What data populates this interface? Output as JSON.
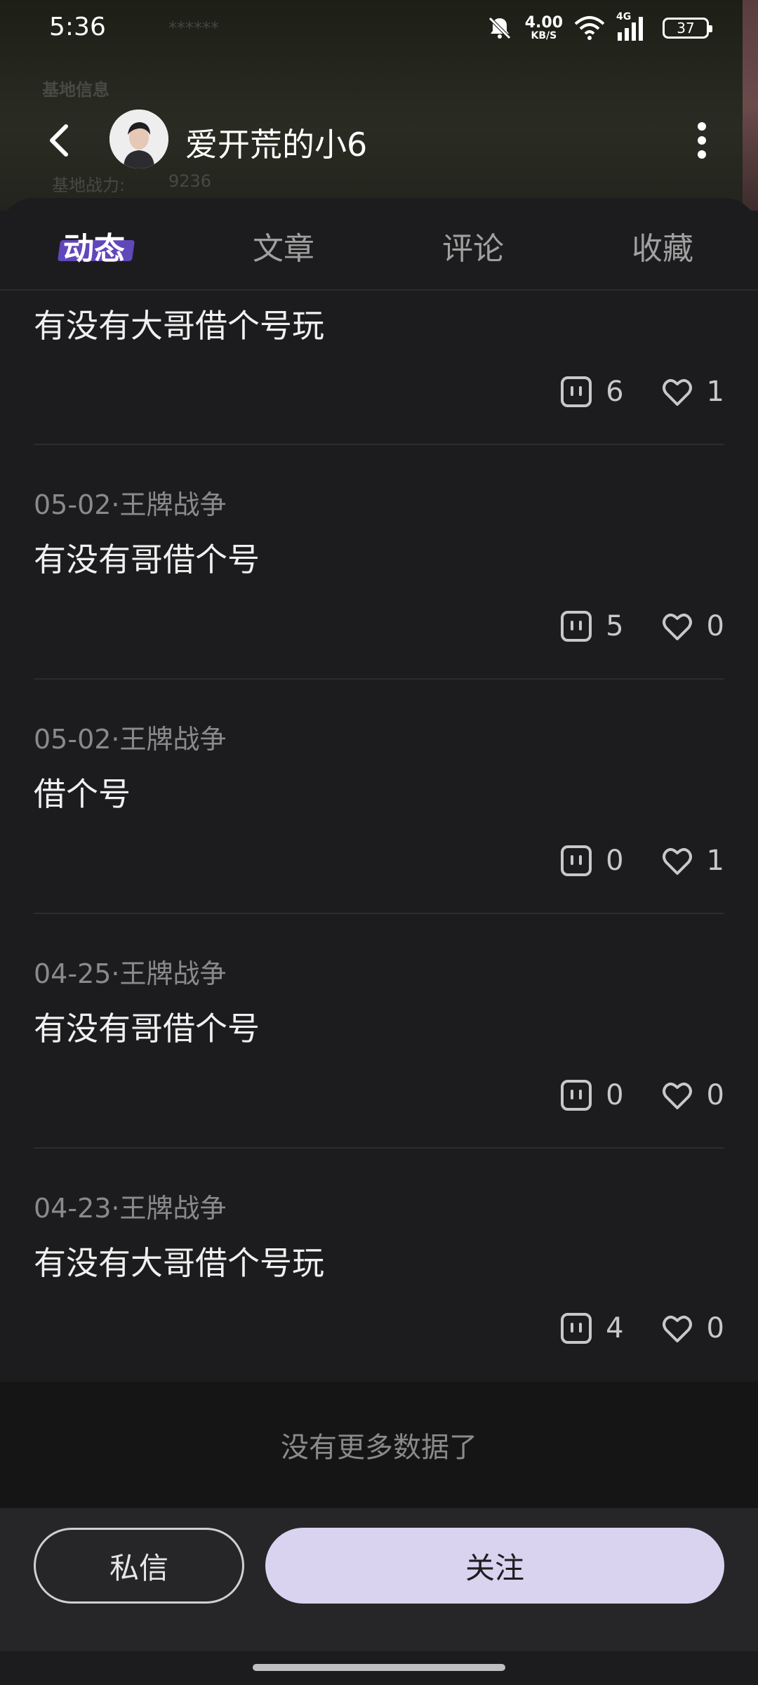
{
  "status_bar": {
    "time": "5:36",
    "net_speed_value": "4.00",
    "net_speed_unit": "KB/S",
    "network_type": "4G",
    "battery": "37",
    "icons": [
      "mute-icon",
      "wifi-icon",
      "signal-icon",
      "battery-icon"
    ]
  },
  "background": {
    "masked_value": "******",
    "section_title": "基地信息",
    "power_label": "基地战力:",
    "power_value": "9236"
  },
  "header": {
    "user_name": "爱开荒的小6"
  },
  "tabs": [
    {
      "label": "动态",
      "active": true
    },
    {
      "label": "文章",
      "active": false
    },
    {
      "label": "评论",
      "active": false
    },
    {
      "label": "收藏",
      "active": false
    }
  ],
  "posts": [
    {
      "meta": "",
      "text": "有没有大哥借个号玩",
      "comments": "6",
      "likes": "1"
    },
    {
      "meta": "05-02·王牌战争",
      "text": "有没有哥借个号",
      "comments": "5",
      "likes": "0"
    },
    {
      "meta": "05-02·王牌战争",
      "text": "借个号",
      "comments": "0",
      "likes": "1"
    },
    {
      "meta": "04-25·王牌战争",
      "text": "有没有哥借个号",
      "comments": "0",
      "likes": "0"
    },
    {
      "meta": "04-23·王牌战争",
      "text": "有没有大哥借个号玩",
      "comments": "4",
      "likes": "0"
    }
  ],
  "feed_end_text": "没有更多数据了",
  "actions": {
    "message_label": "私信",
    "follow_label": "关注"
  },
  "colors": {
    "accent": "#6c4fd6",
    "follow_button": "#d9d3f0",
    "background": "#1c1c1e"
  }
}
